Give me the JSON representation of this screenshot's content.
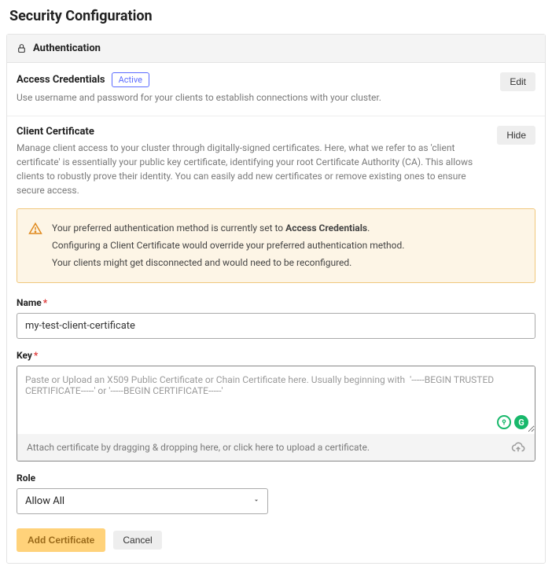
{
  "page": {
    "title": "Security Configuration"
  },
  "panel": {
    "header": "Authentication"
  },
  "access": {
    "title": "Access Credentials",
    "badge": "Active",
    "desc": "Use username and password for your clients to establish connections with your cluster.",
    "edit_label": "Edit"
  },
  "cert": {
    "title": "Client Certificate",
    "hide_label": "Hide",
    "desc": "Manage client access to your cluster through digitally-signed certificates. Here, what we refer to as 'client certificate' is essentially your public key certificate, identifying your root Certificate Authority (CA). This allows clients to robustly prove their identity. You can easily add new certificates or remove existing ones to ensure secure access.",
    "alert": {
      "line1_prefix": "Your preferred authentication method is currently set to ",
      "line1_strong": "Access Credentials",
      "line1_suffix": ".",
      "line2": "Configuring a Client Certificate would override your preferred authentication method.",
      "line3": "Your clients might get disconnected and would need to be reconfigured."
    },
    "form": {
      "name_label": "Name",
      "name_value": "my-test-client-certificate",
      "key_label": "Key",
      "key_placeholder": "Paste or Upload an X509 Public Certificate or Chain Certificate here. Usually beginning with  '-----BEGIN TRUSTED CERTIFICATE-----' or '-----BEGIN CERTIFICATE-----'",
      "upload_hint": "Attach certificate by dragging & dropping here, or click here to upload a certificate.",
      "role_label": "Role",
      "role_value": "Allow All"
    },
    "actions": {
      "add_label": "Add Certificate",
      "cancel_label": "Cancel"
    }
  }
}
